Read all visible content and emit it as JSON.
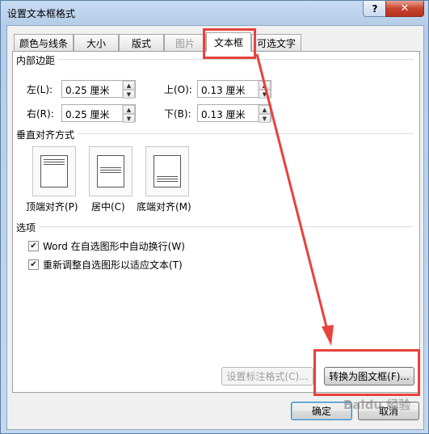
{
  "window": {
    "title": "设置文本框格式",
    "help_label": "?",
    "close_label": "✕"
  },
  "tabs": [
    {
      "label": "颜色与线条"
    },
    {
      "label": "大小"
    },
    {
      "label": "版式"
    },
    {
      "label": "图片"
    },
    {
      "label": "文本框"
    },
    {
      "label": "可选文字"
    }
  ],
  "inner_margin": {
    "heading": "内部边距",
    "left_label": "左(L):",
    "left_value": "0.25 厘米",
    "right_label": "右(R):",
    "right_value": "0.25 厘米",
    "top_label": "上(O):",
    "top_value": "0.13 厘米",
    "bottom_label": "下(B):",
    "bottom_value": "0.13 厘米"
  },
  "vertical_align": {
    "heading": "垂直对齐方式",
    "top_label": "顶端对齐(P)",
    "center_label": "居中(C)",
    "bottom_label": "底端对齐(M)"
  },
  "options": {
    "heading": "选项",
    "wrap_label": "Word 在自选图形中自动换行(W)",
    "wrap_checked": true,
    "resize_label": "重新调整自选图形以适应文本(T)",
    "resize_checked": true
  },
  "buttons": {
    "callout_format": "设置标注格式(C)...",
    "convert_to_frame": "转换为图文框(F)...",
    "ok": "确定",
    "cancel": "取消"
  },
  "watermark": "Baidu 经验",
  "colors": {
    "highlight": "#e8423c"
  }
}
